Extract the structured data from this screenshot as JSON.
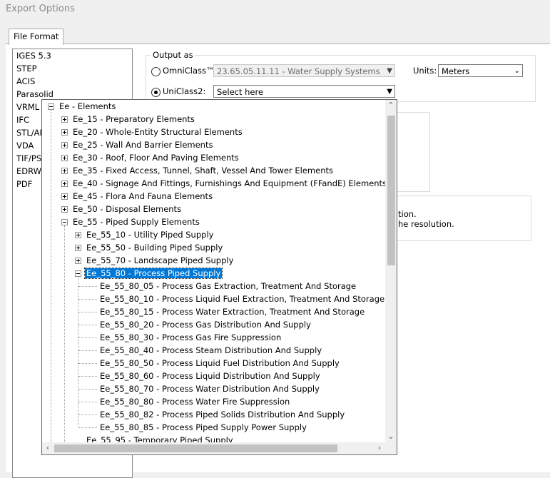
{
  "window": {
    "title": "Export Options"
  },
  "tabs": [
    {
      "label": "File Format"
    }
  ],
  "formats": [
    "IGES 5.3",
    "STEP",
    "ACIS",
    "Parasolid",
    "VRML",
    "IFC",
    "STL/AI",
    "VDA",
    "TIF/PS",
    "EDRW/",
    "PDF"
  ],
  "output": {
    "legend": "Output as",
    "omniclass": {
      "label": "OmniClass™:",
      "value": "23.65.05.11.11 - Water Supply Systems",
      "selected": false
    },
    "uniclass": {
      "label": "UniClass2:",
      "value": "Select here",
      "selected": true
    },
    "units": {
      "label": "Units:",
      "value": "Meters"
    }
  },
  "info": {
    "line1": "tion.",
    "line2": "he resolution."
  },
  "tree": {
    "root": "Ee - Elements",
    "level1": [
      "Ee_15 - Preparatory Elements",
      "Ee_20 - Whole-Entity Structural Elements",
      "Ee_25 - Wall And Barrier Elements",
      "Ee_30 - Roof, Floor And Paving Elements",
      "Ee_35 - Fixed Access, Tunnel, Shaft, Vessel And Tower Elements",
      "Ee_40 - Signage And Fittings, Furnishings And Equipment (FFandE) Elements",
      "Ee_45 - Flora And Fauna Elements",
      "Ee_50 - Disposal Elements",
      "Ee_55 - Piped Supply Elements"
    ],
    "ee55": [
      "Ee_55_10 - Utility Piped Supply",
      "Ee_55_50 - Building Piped Supply",
      "Ee_55_70 - Landscape Piped Supply",
      "Ee_55_80 - Process Piped Supply"
    ],
    "ee5580": [
      "Ee_55_80_05 - Process Gas Extraction, Treatment And Storage",
      "Ee_55_80_10 - Process Liquid Fuel Extraction, Treatment And Storage",
      "Ee_55_80_15 - Process Water Extraction, Treatment And Storage",
      "Ee_55_80_20 - Process Gas Distribution And Supply",
      "Ee_55_80_30 - Process Gas Fire Suppression",
      "Ee_55_80_40 - Process Steam Distribution And Supply",
      "Ee_55_80_50 - Process Liquid Fuel Distribution And Supply",
      "Ee_55_80_60 - Process Liquid Distribution And Supply",
      "Ee_55_80_70 - Process Water Distribution And Supply",
      "Ee_55_80_80 - Process Water Fire Suppression",
      "Ee_55_80_82 - Process Piped Solids Distribution And Supply",
      "Ee_55_80_85 - Process Piped Supply Power Supply"
    ],
    "after": "Ee_55_95 - Temporary Piped Supply"
  },
  "colors": {
    "selection": "#0078d7",
    "panel": "#f0f0f0"
  },
  "icons": {
    "chevron_down": "chevron-down-icon",
    "chevron_up": "chevron-up-icon",
    "chevron_left": "chevron-left-icon",
    "chevron_right": "chevron-right-icon"
  }
}
